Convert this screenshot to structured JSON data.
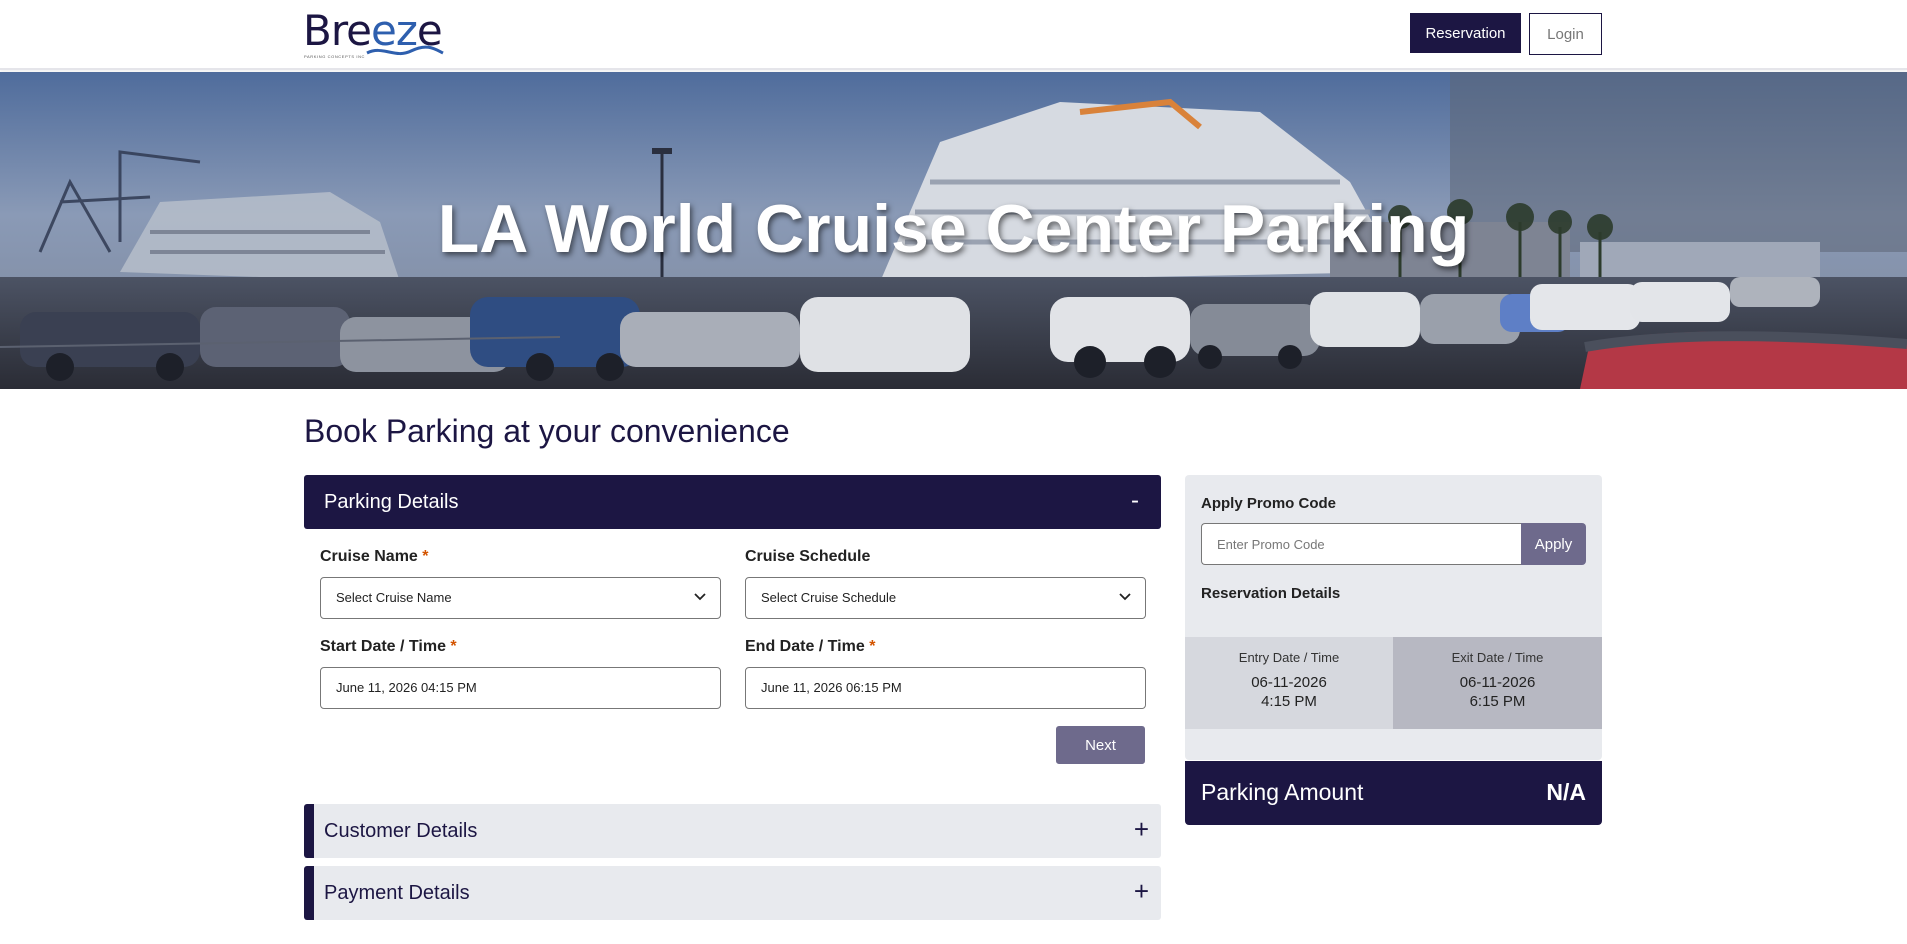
{
  "brand": {
    "logo_text_a": "Br",
    "logo_text_b": "ez",
    "logo_text_c": "e",
    "logo_text_lead": "e",
    "tagline": "PARKING CONCEPTS INC",
    "navy": "#1c1643",
    "accent": "#2e5fae"
  },
  "header": {
    "reservation_label": "Reservation",
    "login_label": "Login"
  },
  "hero": {
    "title": "LA World Cruise Center Parking"
  },
  "main": {
    "title": "Book Parking at your convenience",
    "parking_panel": {
      "label": "Parking Details",
      "toggle": "-",
      "cruise_name_label": "Cruise Name",
      "cruise_name_value": "Select Cruise Name",
      "cruise_schedule_label": "Cruise Schedule",
      "cruise_schedule_value": "Select Cruise Schedule",
      "start_label": "Start Date / Time",
      "start_value": "June 11, 2026 04:15 PM",
      "end_label": "End Date / Time",
      "end_value": "June 11, 2026 06:15 PM",
      "required_mark": "*",
      "next_label": "Next"
    },
    "customer_panel": {
      "label": "Customer Details",
      "toggle": "+"
    },
    "payment_panel": {
      "label": "Payment Details",
      "toggle": "+"
    }
  },
  "sidebar": {
    "promo_label": "Apply Promo Code",
    "promo_placeholder": "Enter Promo Code",
    "apply_label": "Apply",
    "reservation_label": "Reservation Details",
    "entry": {
      "title": "Entry Date / Time",
      "date": "06-11-2026",
      "time": "4:15 PM"
    },
    "exit": {
      "title": "Exit Date / Time",
      "date": "06-11-2026",
      "time": "6:15 PM"
    },
    "amount_label": "Parking Amount",
    "amount_value": "N/A"
  }
}
